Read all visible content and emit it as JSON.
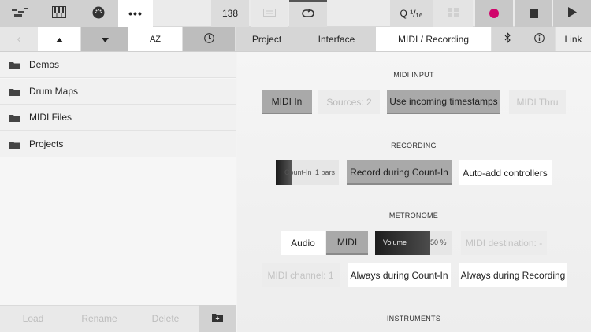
{
  "toolbar": {
    "tempo": "138",
    "quantize": "Q ¹/₁₆",
    "tempo_ghost": "",
    "icons": [
      "sequencer-icon",
      "piano-icon",
      "midi-port-icon",
      "more-icon",
      "keyboard-icon",
      "loop-icon",
      "grid-icon",
      "record-icon",
      "stop-icon",
      "play-icon"
    ],
    "record_color": "#d0056b"
  },
  "nav": {
    "sort_label": "AZ",
    "tabs": [
      "Project",
      "Interface",
      "MIDI / Recording"
    ],
    "link_label": "Link"
  },
  "sidebar": {
    "items": [
      {
        "label": "Demos"
      },
      {
        "label": "Drum Maps"
      },
      {
        "label": "MIDI Files"
      },
      {
        "label": "Projects"
      }
    ],
    "footer": {
      "load": "Load",
      "rename": "Rename",
      "delete": "Delete"
    }
  },
  "midi_input": {
    "title": "MIDI INPUT",
    "midi_in": "MIDI In",
    "sources": "Sources: 2",
    "timestamps": "Use incoming timestamps",
    "midi_thru": "MIDI Thru"
  },
  "recording": {
    "title": "RECORDING",
    "count_in_label": "Count-In",
    "count_in_value": "1 bars",
    "record_during_count_in": "Record during Count-In",
    "auto_add_controllers": "Auto-add controllers"
  },
  "metronome": {
    "title": "METRONOME",
    "audio": "Audio",
    "midi": "MIDI",
    "volume_label": "Volume",
    "volume_value": "50 %",
    "volume_fraction": 0.5,
    "midi_destination": "MIDI destination: -",
    "midi_channel": "MIDI channel: 1",
    "always_count_in": "Always during Count-In",
    "always_recording": "Always during Recording"
  },
  "instruments": {
    "title": "INSTRUMENTS"
  }
}
